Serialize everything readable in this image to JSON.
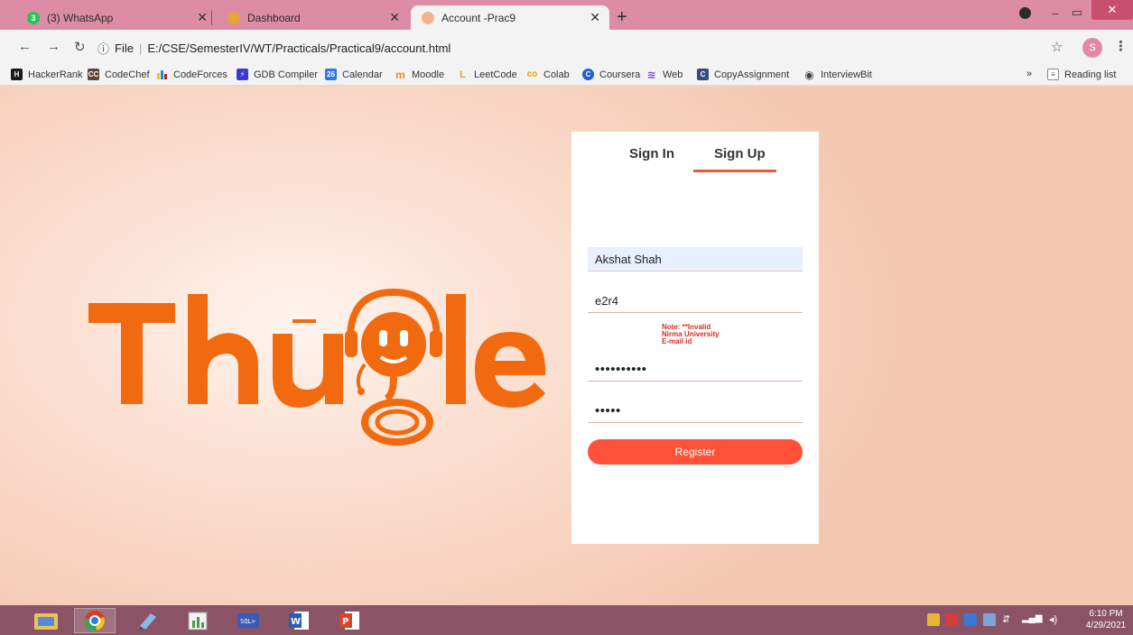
{
  "browser": {
    "tabs": [
      {
        "title": "(3) WhatsApp",
        "icon": "whatsapp-icon",
        "badge": "3"
      },
      {
        "title": "Dashboard",
        "icon": "dashboard-icon"
      },
      {
        "title": "Account -Prac9",
        "icon": "page-icon",
        "active": true
      }
    ],
    "url": {
      "scheme_label": "File",
      "path": "E:/CSE/SemesterIV/WT/Practicals/Practical9/account.html"
    },
    "profile_initial": "S",
    "bookmarks": [
      {
        "label": "HackerRank",
        "icon": "hackerrank-icon",
        "icon_text": "H"
      },
      {
        "label": "CodeChef",
        "icon": "codechef-icon",
        "icon_text": "CC"
      },
      {
        "label": "CodeForces",
        "icon": "codeforces-icon"
      },
      {
        "label": "GDB Compiler",
        "icon": "gdb-icon",
        "icon_text": "⚡"
      },
      {
        "label": "Calendar",
        "icon": "calendar-icon",
        "icon_text": "26"
      },
      {
        "label": "Moodle",
        "icon": "moodle-icon",
        "icon_text": "m"
      },
      {
        "label": "LeetCode",
        "icon": "leetcode-icon",
        "icon_text": "L"
      },
      {
        "label": "Colab",
        "icon": "colab-icon",
        "icon_text": "co"
      },
      {
        "label": "Coursera",
        "icon": "coursera-icon",
        "icon_text": "C"
      },
      {
        "label": "Web",
        "icon": "web-icon",
        "icon_text": "≋"
      },
      {
        "label": "CopyAssignment",
        "icon": "copyassignment-icon",
        "icon_text": "C"
      },
      {
        "label": "InterviewBit",
        "icon": "interviewbit-icon",
        "icon_text": "◉"
      }
    ],
    "overflow_label": "»",
    "reading_list_label": "Reading list"
  },
  "page": {
    "logo_text": "Thugle",
    "tabs": {
      "sign_in": "Sign In",
      "sign_up": "Sign Up",
      "active": "sign_up"
    },
    "form": {
      "name_value": "Akshat Shah",
      "email_value": "e2r4",
      "note_line1": "Note: **Invalid",
      "note_line2": "Nirma University",
      "note_line3": "E-mail id",
      "password_mask": "••••••••••",
      "confirm_mask": "•••••",
      "register_label": "Register"
    },
    "colors": {
      "accent": "#ff5238",
      "logo": "#f26a10",
      "error": "#d62b2b"
    }
  },
  "taskbar": {
    "time": "6:10 PM",
    "date": "4/29/2021",
    "apps": [
      "file-explorer-icon",
      "chrome-icon",
      "notepad-icon",
      "chart-app-icon",
      "sql-icon",
      "word-icon",
      "powerpoint-icon"
    ]
  }
}
